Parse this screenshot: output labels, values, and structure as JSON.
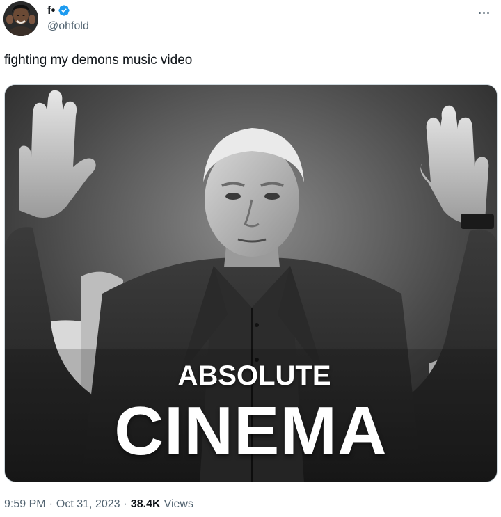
{
  "author": {
    "display_name": "f•",
    "handle": "@ohfold",
    "verified": true,
    "verified_color": "#1d9bf0"
  },
  "tweet": {
    "text": "fighting my demons music video"
  },
  "media": {
    "caption_line1": "ABSOLUTE",
    "caption_line2": "CINEMA"
  },
  "meta": {
    "time": "9:59 PM",
    "separator1": "·",
    "date": "Oct 31, 2023",
    "separator2": "·",
    "views_count": "38.4K",
    "views_label": "Views"
  },
  "icons": {
    "more": "more-icon",
    "verified": "verified-badge-icon"
  }
}
